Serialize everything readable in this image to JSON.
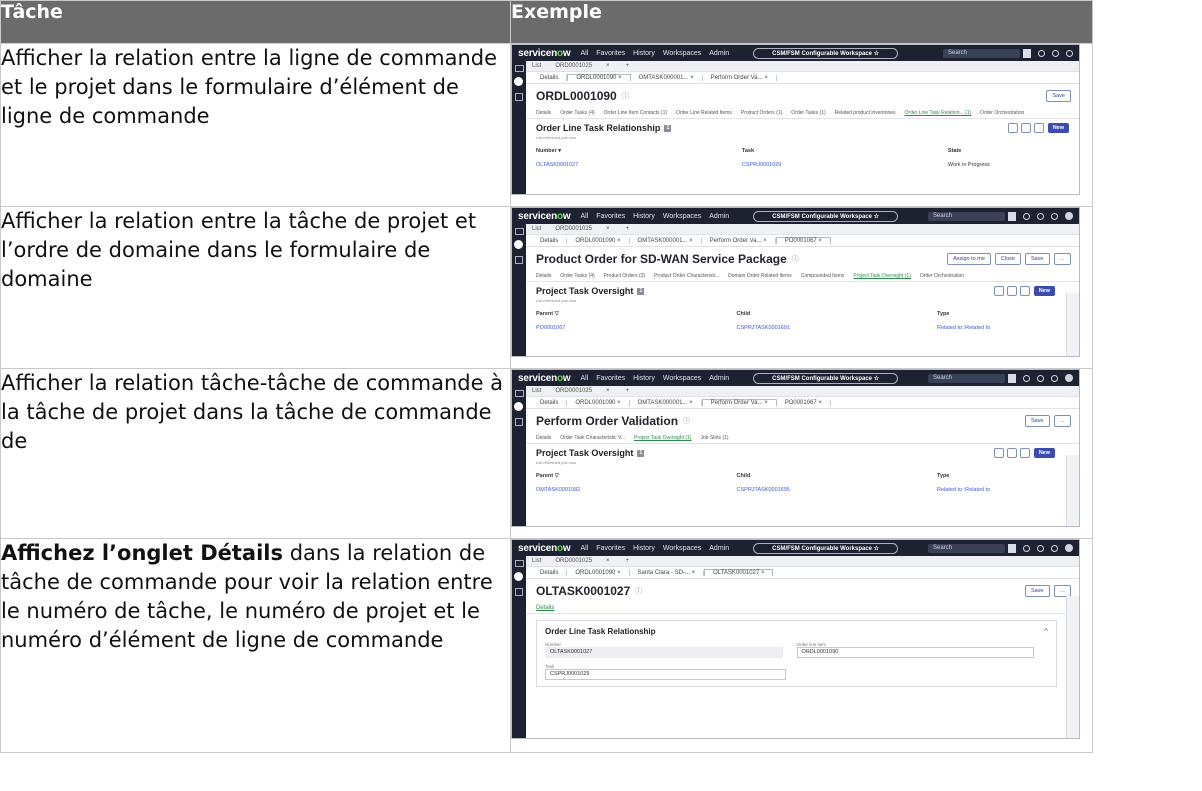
{
  "header": {
    "col_task": "Tâche",
    "col_example": "Exemple"
  },
  "rows": [
    {
      "task_text": "Afficher la relation entre la ligne de commande et le projet dans le formulaire d’élément de ligne de commande",
      "example": {
        "tabs1": [
          "List",
          "ORD0001025",
          "×",
          "+"
        ],
        "tabs2": [
          "Details",
          "ORDL0001090  ×",
          "OMTASK000001...  ×",
          "Perform Order Va...  ×"
        ],
        "title": "ORDL0001090",
        "actions": [
          "Save"
        ],
        "related_tabs": [
          "Details",
          "Order Tasks (4)",
          "Order Line Item Contacts (1)",
          "Order Line Related Items",
          "Product Orders (1)",
          "Order Tasks (1)",
          "Related product inventories",
          "Order Line Task Relation... (1)",
          "Order Orchestration"
        ],
        "panel_title": "Order Line Task Relationship",
        "panel_sub": "List refreshed just now",
        "columns": [
          "Number ▾",
          "Task",
          "State"
        ],
        "cells": [
          "OLTASK0001027",
          "CSPRJ0001029",
          "Work in Progress"
        ]
      }
    },
    {
      "task_text": "Afficher la relation entre la tâche de projet et l’ordre de domaine dans le formulaire de domaine",
      "example": {
        "tabs1": [
          "List",
          "ORD0001025",
          "×",
          "+"
        ],
        "tabs2": [
          "Details",
          "ORDL0001090  ×",
          "OMTASK000001...  ×",
          "Perform Order Va...  ×",
          "PO0001067  ×"
        ],
        "title": "Product Order for SD-WAN Service Package",
        "actions": [
          "Assign to me",
          "Close",
          "Save",
          "…"
        ],
        "related_tabs": [
          "Details",
          "Order Tasks (4)",
          "Product Orders (3)",
          "Product Order Characteristi...",
          "Domain Order Related Items",
          "Compounded Items",
          "Project Task Oversight (1)",
          "Order Orchestration"
        ],
        "panel_title": "Project Task Oversight",
        "panel_sub": "List refreshed just now",
        "columns": [
          "Parent ▽",
          "Child",
          "Type"
        ],
        "cells": [
          "PO0001067",
          "CSPRJTASK0001691",
          "Related to::Related to"
        ]
      }
    },
    {
      "task_text": "Afficher la relation tâche-tâche de commande à la tâche de projet dans la tâche de commande de",
      "example": {
        "tabs1": [
          "List",
          "ORD0001025",
          "×",
          "+"
        ],
        "tabs2": [
          "Details",
          "ORDL0001090  ×",
          "OMTASK000001...  ×",
          "Perform Order Va...  ×",
          "PO0001067  ×"
        ],
        "title": "Perform Order Validation",
        "actions": [
          "Save",
          "…"
        ],
        "related_tabs": [
          "Details",
          "Order Task Characteristic V...",
          "Project Task Oversight (1)",
          "Job Slots (1)"
        ],
        "panel_title": "Project Task Oversight",
        "panel_sub": "List refreshed just now",
        "columns": [
          "Parent ▽",
          "Child",
          "Type"
        ],
        "cells": [
          "OMTASK0001082",
          "CSPRJTASK0001695",
          "Related to::Related to"
        ]
      }
    },
    {
      "task_bold": "Affichez l’onglet Détails",
      "task_text": " dans la relation de tâche de commande pour voir la relation entre le numéro de tâche, le numéro de projet et le numéro d’élément de ligne de commande",
      "example": {
        "tabs1": [
          "List",
          "ORD0001025",
          "×",
          "+"
        ],
        "tabs2": [
          "Details",
          "ORDL0001090  ×",
          "Santa Clara - SD-...  ×",
          "OLTASK0001027  ×"
        ],
        "title": "OLTASK0001027",
        "actions": [
          "Save",
          "…"
        ],
        "detail_tab": "Details",
        "card_title": "Order Line Task Relationship",
        "fields": [
          {
            "label": "Number",
            "value": "OLTASK0001027"
          },
          {
            "label": "Order line item",
            "value": "ORDL0001090"
          },
          {
            "label": "Task",
            "value": "CSPRJ0001029"
          }
        ]
      }
    }
  ],
  "app": {
    "brand_a": "servicen",
    "brand_b": "o",
    "brand_c": "w",
    "nav": [
      "All",
      "Favorites",
      "History",
      "Workspaces",
      "Admin"
    ],
    "workspace": "CSM/FSM Configurable Workspace ☆",
    "search": "Search"
  }
}
